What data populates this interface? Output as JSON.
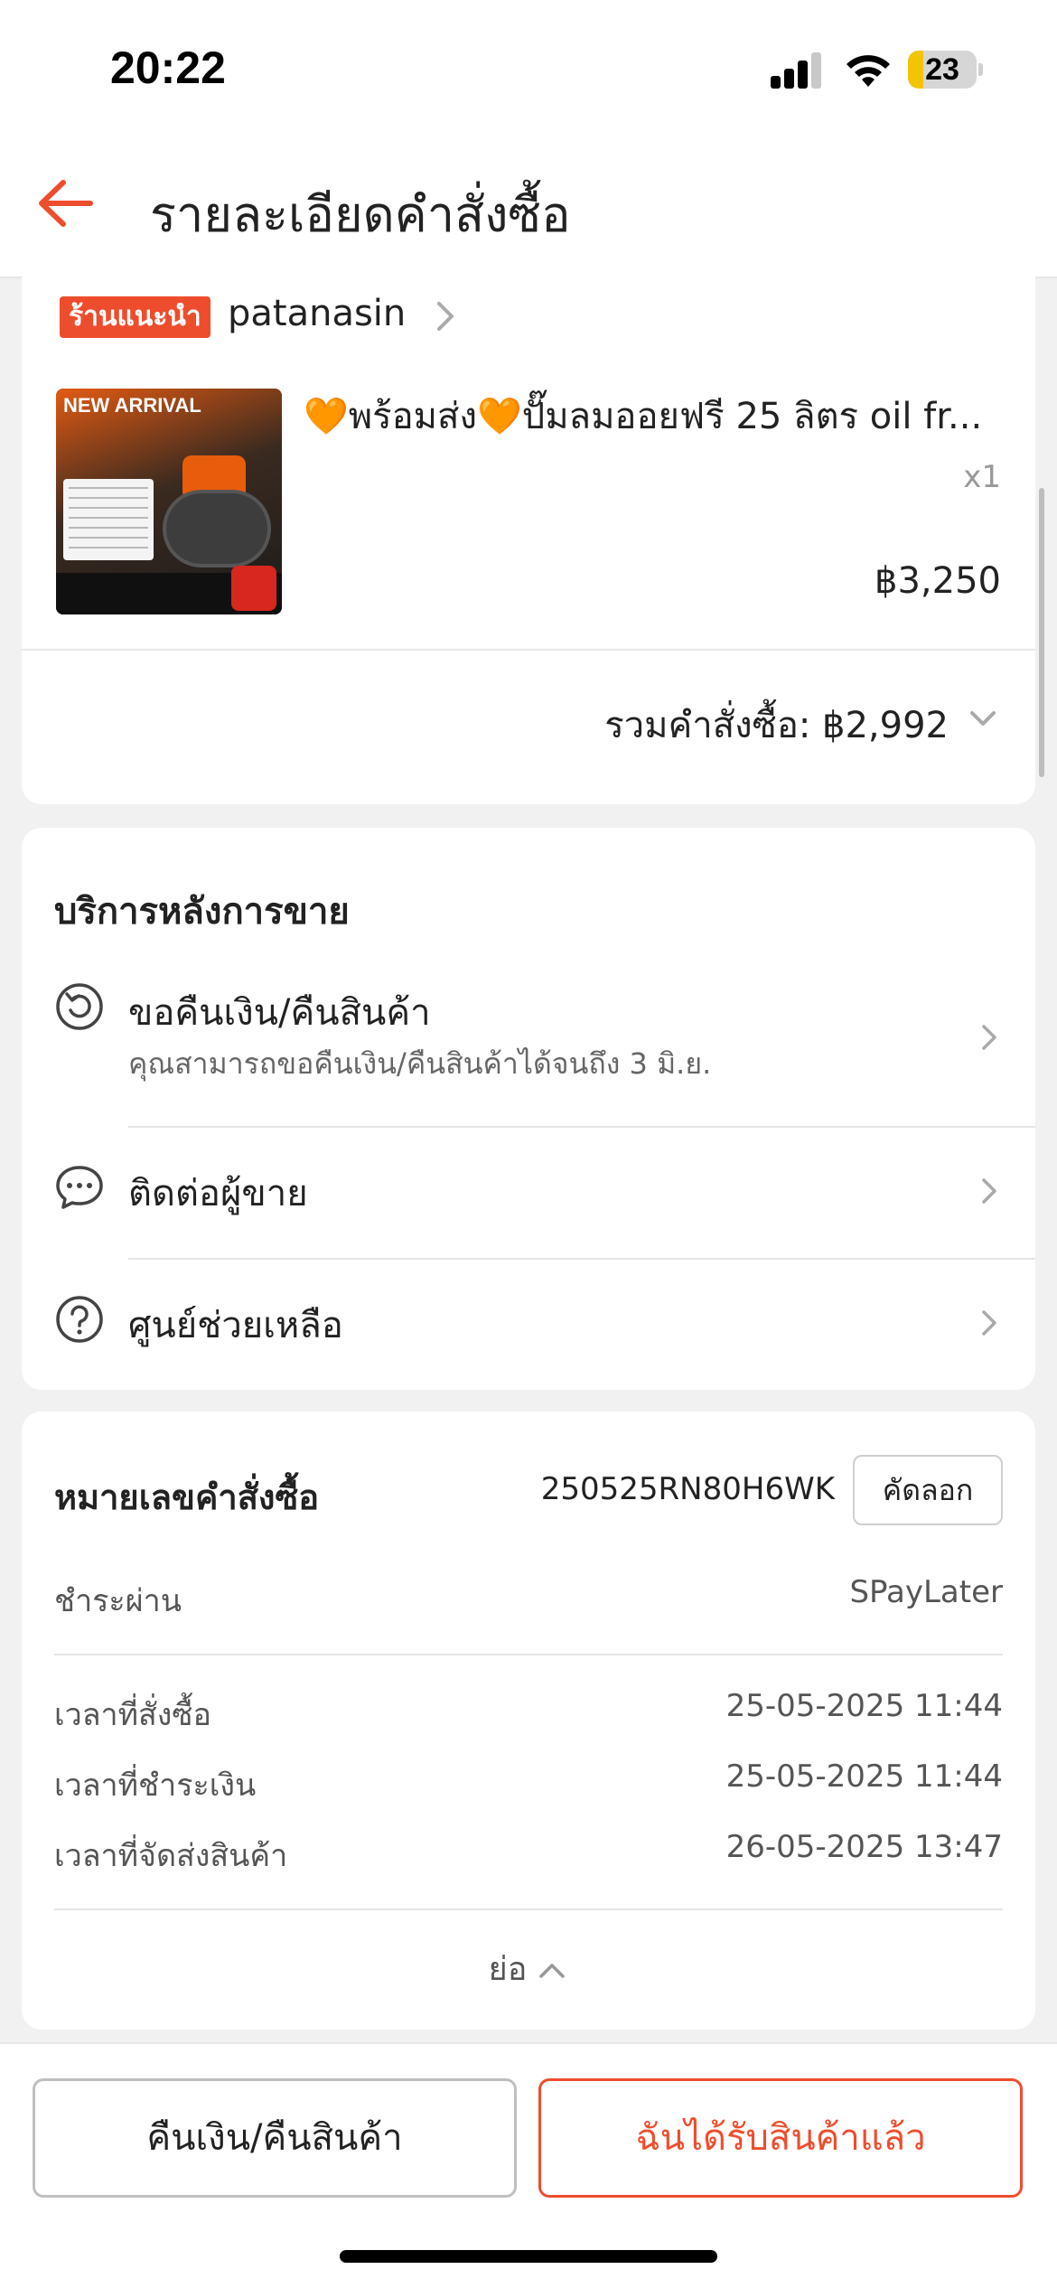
{
  "status_bar": {
    "time": "20:22",
    "battery": "23",
    "battery_level": 0.23
  },
  "header": {
    "title": "รายละเอียดคำสั่งซื้อ"
  },
  "shop": {
    "badge": "ร้านแนะนำ",
    "name": "patanasin"
  },
  "product": {
    "title": "🧡พร้อมส่ง🧡ปั๊มลมออยฟรี 25 ลิตร oil fr...",
    "quantity": "x1",
    "price": "฿3,250",
    "image_texts": {
      "new_arrival": "NEW ARRIVAL"
    }
  },
  "order_total": {
    "text": "รวมคำสั่งซื้อ: ฿2,992"
  },
  "after_sales": {
    "title": "บริการหลังการขาย",
    "items": [
      {
        "label": "ขอคืนเงิน/คืนสินค้า",
        "sub": "คุณสามารถขอคืนเงิน/คืนสินค้าได้จนถึง 3 มิ.ย.",
        "icon": "return-icon"
      },
      {
        "label": "ติดต่อผู้ขาย",
        "icon": "chat-icon"
      },
      {
        "label": "ศูนย์ช่วยเหลือ",
        "icon": "help-icon"
      }
    ]
  },
  "order_info": {
    "number_label": "หมายเลขคำสั่งซื้อ",
    "number": "250525RN80H6WK",
    "copy_label": "คัดลอก",
    "payment_label": "ชำระผ่าน",
    "payment_value": "SPayLater",
    "times": [
      {
        "label": "เวลาที่สั่งซื้อ",
        "value": "25-05-2025 11:44"
      },
      {
        "label": "เวลาที่ชำระเงิน",
        "value": "25-05-2025 11:44"
      },
      {
        "label": "เวลาที่จัดส่งสินค้า",
        "value": "26-05-2025 13:47"
      }
    ],
    "collapse_label": "ย่อ"
  },
  "bottom_bar": {
    "return_label": "คืนเงิน/คืนสินค้า",
    "received_label": "ฉันได้รับสินค้าแล้ว"
  },
  "colors": {
    "accent": "#ee4d2d"
  }
}
